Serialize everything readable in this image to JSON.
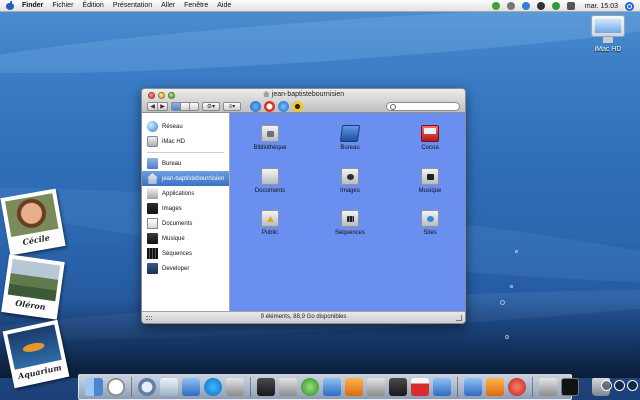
{
  "menubar": {
    "app_name": "Finder",
    "items": [
      "Fichier",
      "Édition",
      "Présentation",
      "Aller",
      "Fenêtre",
      "Aide"
    ],
    "clock": "mar. 15:03"
  },
  "desktop": {
    "hd_label": "iMac HD",
    "polaroids": [
      "Cécile",
      "Oléron",
      "Aquarium"
    ]
  },
  "window": {
    "title": "jean-baptistebournisien",
    "sidebar": [
      {
        "label": "Réseau",
        "icon": "globe-icon"
      },
      {
        "label": "iMac HD",
        "icon": "hard-disk-icon"
      },
      {
        "label": "Bureau",
        "icon": "desktop-folder-icon"
      },
      {
        "label": "jean-baptistebournisien",
        "icon": "home-icon",
        "active": true
      },
      {
        "label": "Applications",
        "icon": "applications-icon"
      },
      {
        "label": "Images",
        "icon": "pictures-icon"
      },
      {
        "label": "Documents",
        "icon": "documents-icon"
      },
      {
        "label": "Musique",
        "icon": "music-icon"
      },
      {
        "label": "Séquences",
        "icon": "movies-icon"
      },
      {
        "label": "Developer",
        "icon": "developer-folder-icon"
      }
    ],
    "items": [
      {
        "label": "Bibliothèque",
        "icon": "library-folder-icon"
      },
      {
        "label": "Bureau",
        "icon": "desktop-folder-icon"
      },
      {
        "label": "Cocoa",
        "icon": "cocoa-folder-icon"
      },
      {
        "label": "Documents",
        "icon": "documents-folder-icon"
      },
      {
        "label": "Images",
        "icon": "pictures-folder-icon"
      },
      {
        "label": "Musique",
        "icon": "music-folder-icon"
      },
      {
        "label": "Public",
        "icon": "public-folder-icon"
      },
      {
        "label": "Séquences",
        "icon": "movies-folder-icon"
      },
      {
        "label": "Sites",
        "icon": "sites-folder-icon"
      }
    ],
    "status": "9 éléments, 88,9 Go disponibles"
  },
  "colors": {
    "content_bg": "#6b8ff0",
    "selection": "#3d70c2"
  }
}
